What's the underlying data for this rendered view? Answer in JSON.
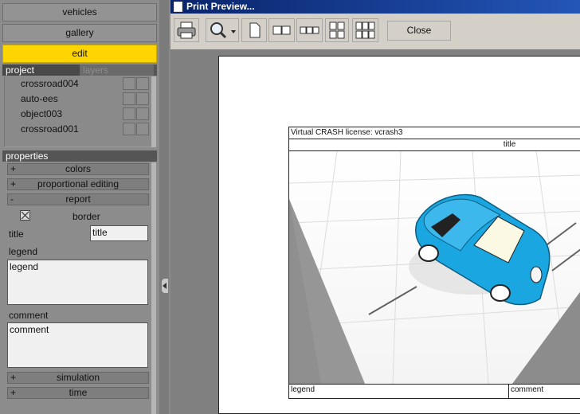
{
  "nav": {
    "vehicles": "vehicles",
    "gallery": "gallery",
    "edit": "edit"
  },
  "project_tabs": {
    "project": "project",
    "layers": "layers"
  },
  "project_items": [
    "crossroad004",
    "auto-ees",
    "object003",
    "crossroad001"
  ],
  "properties": {
    "header": "properties",
    "sections": {
      "colors": {
        "sign": "+",
        "label": "colors"
      },
      "proportional_editing": {
        "sign": "+",
        "label": "proportional editing"
      },
      "report": {
        "sign": "-",
        "label": "report"
      },
      "simulation": {
        "sign": "+",
        "label": "simulation"
      },
      "time": {
        "sign": "+",
        "label": "time"
      }
    },
    "border_label": "border",
    "title_label": "title",
    "title_value": "title",
    "legend_label": "legend",
    "legend_value": "legend",
    "comment_label": "comment",
    "comment_value": "comment"
  },
  "window": {
    "title": "Print Preview...",
    "close_label": "Close"
  },
  "report": {
    "license": "Virtual CRASH license: vcrash3",
    "title": "title",
    "legend": "legend",
    "comment": "comment"
  },
  "colors": {
    "accent": "#ffd500",
    "car": "#1aa6e0",
    "titlebar": "#0a246a"
  },
  "icons": [
    "printer-icon",
    "zoom-icon",
    "one-page-icon",
    "two-pages-icon",
    "three-pages-icon",
    "four-pages-icon",
    "six-pages-icon",
    "checkbox-checked-icon",
    "collapse-arrow-icon"
  ]
}
